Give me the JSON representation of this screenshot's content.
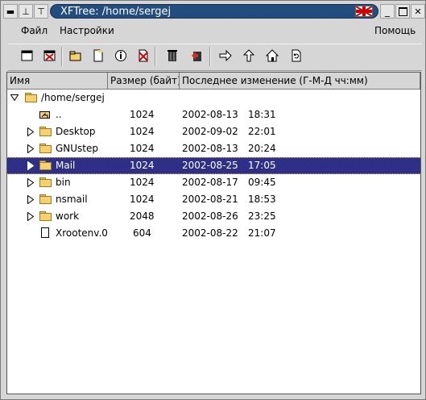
{
  "window": {
    "title": "XFTree: /home/sergej"
  },
  "menu": {
    "file": "Файл",
    "settings": "Настройки",
    "help": "Помощь"
  },
  "toolbar": {
    "icons": [
      "new-window-icon",
      "close-window-icon",
      "new-folder-icon",
      "new-file-icon",
      "info-icon",
      "delete-icon",
      "trash-icon",
      "undo-icon",
      "go-to-icon",
      "up-icon",
      "home-icon",
      "refresh-icon"
    ]
  },
  "columns": {
    "name": "Имя",
    "size": "Размер (байт)",
    "modified": "Последнее изменение (Г-М-Д чч:мм)"
  },
  "tree": {
    "root": "/home/sergej",
    "rows": [
      {
        "name": "..",
        "size": "1024",
        "date": "2002-08-13",
        "time": "18:31"
      },
      {
        "name": "Desktop",
        "size": "1024",
        "date": "2002-09-02",
        "time": "22:01"
      },
      {
        "name": "GNUstep",
        "size": "1024",
        "date": "2002-08-13",
        "time": "20:24"
      },
      {
        "name": "Mail",
        "size": "1024",
        "date": "2002-08-25",
        "time": "17:05"
      },
      {
        "name": "bin",
        "size": "1024",
        "date": "2002-08-17",
        "time": "09:45"
      },
      {
        "name": "nsmail",
        "size": "1024",
        "date": "2002-08-21",
        "time": "18:53"
      },
      {
        "name": "work",
        "size": "2048",
        "date": "2002-08-26",
        "time": "23:25"
      },
      {
        "name": "Xrootenv.0",
        "size": "604",
        "date": "2002-08-22",
        "time": "21:07"
      }
    ]
  },
  "colors": {
    "selection": "#2d3086",
    "title_bar": "#234d7e"
  }
}
